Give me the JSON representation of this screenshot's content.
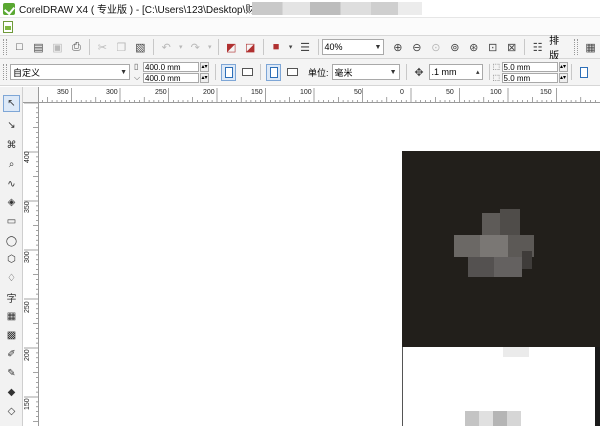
{
  "window": {
    "title": "CorelDRAW X4 ( 专业版 ) - [C:\\Users\\123\\Desktop\\财务"
  },
  "toolbar_standard": {
    "zoom_value": "40%",
    "layout_button": "排版"
  },
  "toolbar_property": {
    "preset_value": "自定义",
    "page_width": "400.0 mm",
    "page_height": "400.0 mm",
    "units_label": "单位:",
    "units_value": "毫米",
    "nudge_value": ".1 mm",
    "duplicate_x": "5.0 mm",
    "duplicate_y": "5.0 mm"
  },
  "horizontal_ruler": {
    "labels": [
      "350",
      "300",
      "250",
      "200",
      "150",
      "100",
      "50",
      "0",
      "50",
      "100",
      "150"
    ]
  },
  "vertical_ruler": {
    "labels": [
      "400",
      "350",
      "300",
      "250",
      "200",
      "150"
    ]
  },
  "toolbox": {
    "tools": [
      "pick-tool-icon",
      "shape-tool-icon",
      "crop-tool-icon",
      "zoom-tool-icon",
      "freehand-tool-icon",
      "smart-fill-icon",
      "rectangle-tool-icon",
      "ellipse-tool-icon",
      "polygon-tool-icon",
      "basic-shapes-icon",
      "text-tool-icon",
      "table-tool-icon",
      "interactive-blend-icon",
      "eyedropper-icon",
      "outline-pen-icon",
      "fill-tool-icon",
      "interactive-fill-icon"
    ],
    "text_tool_glyph": "字"
  },
  "colors": {
    "artwork_dark": "#221f1b",
    "accent_blue": "#2d6fb8",
    "app_green": "#5aa832"
  }
}
